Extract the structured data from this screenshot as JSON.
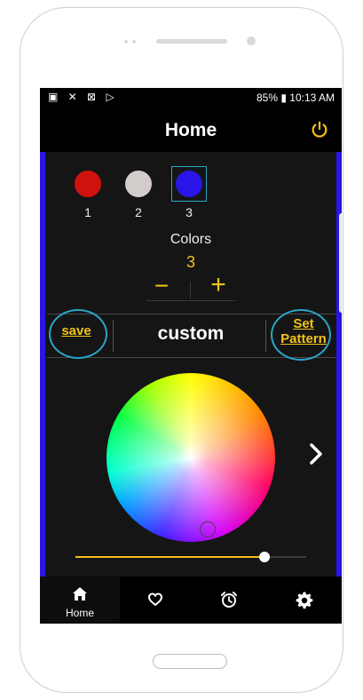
{
  "statusbar": {
    "left_icons": "▣ ✕ ⊠ ▷",
    "right_text": "85% ▮ 10:13 AM"
  },
  "header": {
    "title": "Home",
    "power_icon": "power-icon"
  },
  "swatches": [
    {
      "label": "1",
      "color": "#d0120e"
    },
    {
      "label": "2",
      "color": "#d2cccb"
    },
    {
      "label": "3",
      "color": "#2a14e8",
      "selected": true
    }
  ],
  "colors_control": {
    "label": "Colors",
    "count": "3",
    "minus": "−",
    "plus": "+"
  },
  "actions": {
    "save_label": "save",
    "pattern_name": "custom",
    "set_pattern_line1": "Set",
    "set_pattern_line2": "Pattern"
  },
  "brightness": {
    "value": 0.82
  },
  "nav": {
    "home_label": "Home",
    "items": [
      "home-icon",
      "heart-icon",
      "alarm-icon",
      "settings-icon"
    ]
  },
  "colors": {
    "accent": "#f2c21b",
    "border_blue": "#2a14e8",
    "highlight": "#2aa6c8"
  }
}
